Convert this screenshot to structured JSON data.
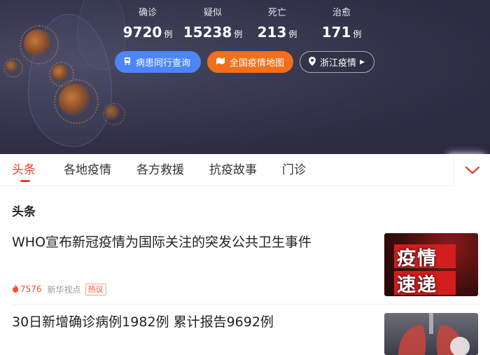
{
  "stats": [
    {
      "label": "确诊",
      "value": "9720",
      "unit": "例"
    },
    {
      "label": "疑似",
      "value": "15238",
      "unit": "例"
    },
    {
      "label": "死亡",
      "value": "213",
      "unit": "例"
    },
    {
      "label": "治愈",
      "value": "171",
      "unit": "例"
    }
  ],
  "actions": {
    "patient_trip_query": "病患同行查询",
    "national_map": "全国疫情地图",
    "zhejiang": "浙江疫情"
  },
  "tabs": [
    "头条",
    "各地疫情",
    "各方救援",
    "抗疫故事",
    "门诊"
  ],
  "section_title": "头条",
  "news": [
    {
      "title": "WHO宣布新冠疫情为国际关注的突发公共卫生事件",
      "heat": "7576",
      "source": "新华视点",
      "tag": "热议",
      "thumb_text": [
        "疫情",
        "速递"
      ]
    },
    {
      "title": "30日新增确诊病例1982例 累计报告9692例"
    }
  ],
  "colors": {
    "accent": "#e5412d",
    "blue_pill": "#4d86f5",
    "orange_pill": "#f26f1b"
  }
}
